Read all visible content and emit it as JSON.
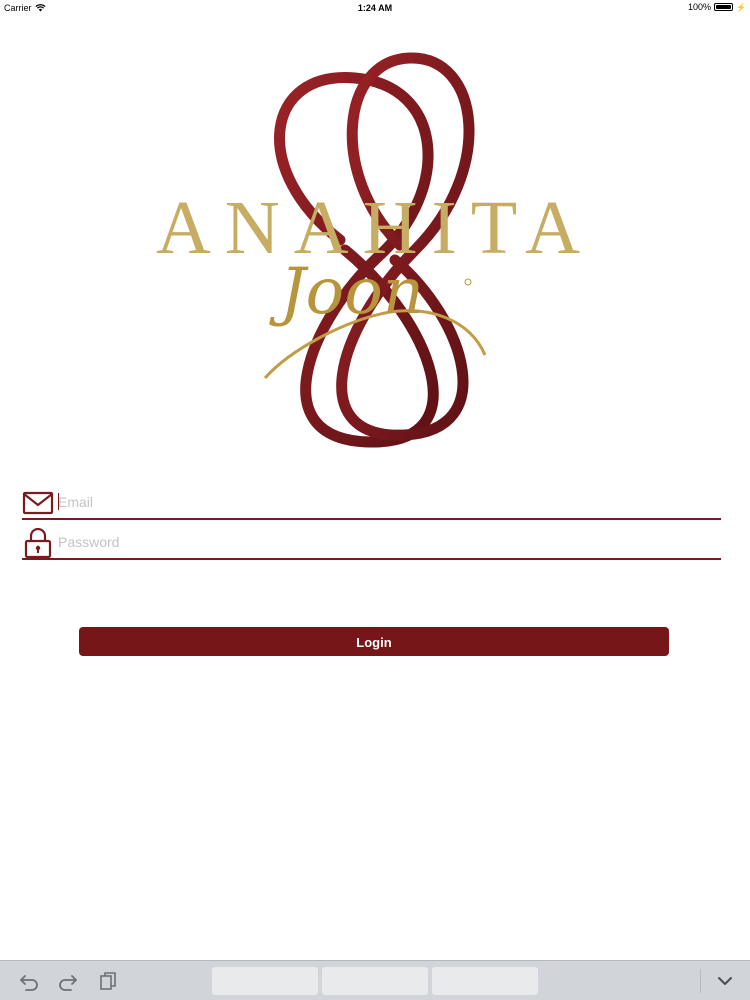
{
  "status_bar": {
    "carrier": "Carrier",
    "time": "1:24 AM",
    "battery": "100%"
  },
  "logo": {
    "wordmark": "ANAHITA",
    "script": "Joon",
    "colors": {
      "ribbon": "#7a1b1f",
      "gold": "#c7ad64"
    }
  },
  "form": {
    "email": {
      "placeholder": "Email",
      "value": "",
      "icon": "envelope-icon"
    },
    "password": {
      "placeholder": "Password",
      "value": "",
      "icon": "lock-icon"
    },
    "login_label": "Login"
  },
  "keyboard_bar": {
    "icons": [
      "undo-icon",
      "redo-icon",
      "paste-icon",
      "dismiss-keyboard-icon"
    ],
    "suggestions": [
      "",
      "",
      ""
    ]
  },
  "colors": {
    "accent": "#761619",
    "background": "#ffffff",
    "bar": "#d1d4d9"
  }
}
